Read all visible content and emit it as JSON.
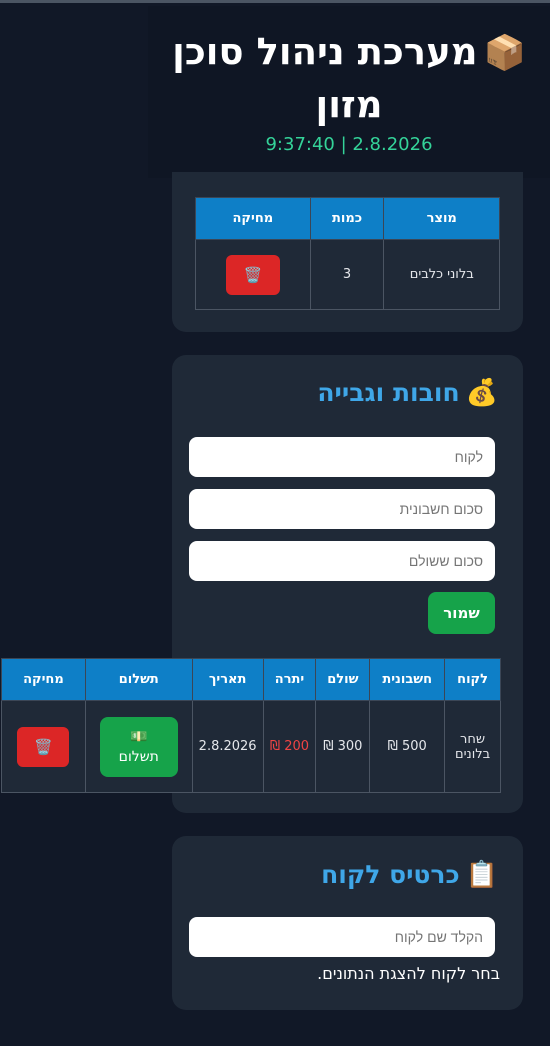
{
  "header": {
    "title_emoji": "📦",
    "title": "מערכת ניהול סוכן מזון",
    "datetime": "9:37:40 | 2.8.2026"
  },
  "inventory": {
    "columns": [
      "מוצר",
      "כמות",
      "מחיקה"
    ],
    "rows": [
      {
        "product": "בלוני כלבים",
        "qty": "3",
        "delete_icon": "🗑️"
      }
    ]
  },
  "debts": {
    "title_emoji": "💰",
    "title": "חובות וגבייה",
    "customer_placeholder": "לקוח",
    "invoice_placeholder": "סכום חשבונית",
    "paid_placeholder": "סכום ששולם",
    "save_label": "שמור",
    "columns": [
      "לקוח",
      "חשבונית",
      "שולם",
      "יתרה",
      "תאריך",
      "תשלום",
      "מחיקה"
    ],
    "rows": [
      {
        "customer": "שחר בלונים",
        "invoice": "500 ₪",
        "paid": "300 ₪",
        "balance": "200 ₪",
        "date": "2.8.2026",
        "pay_icon": "💵",
        "pay_label": "תשלום",
        "delete_icon": "🗑️"
      }
    ]
  },
  "customer_card": {
    "title_emoji": "📋",
    "title": "כרטיס לקוח",
    "search_placeholder": "הקלד שם לקוח",
    "hint": "בחר לקוח להצגת הנתונים."
  },
  "colors": {
    "background": "#111827",
    "card": "#1f2937",
    "accent": "#3fa7e8",
    "table_header": "#0e7fc7",
    "success": "#16a34a",
    "danger": "#dc2626",
    "clock": "#34d399"
  }
}
